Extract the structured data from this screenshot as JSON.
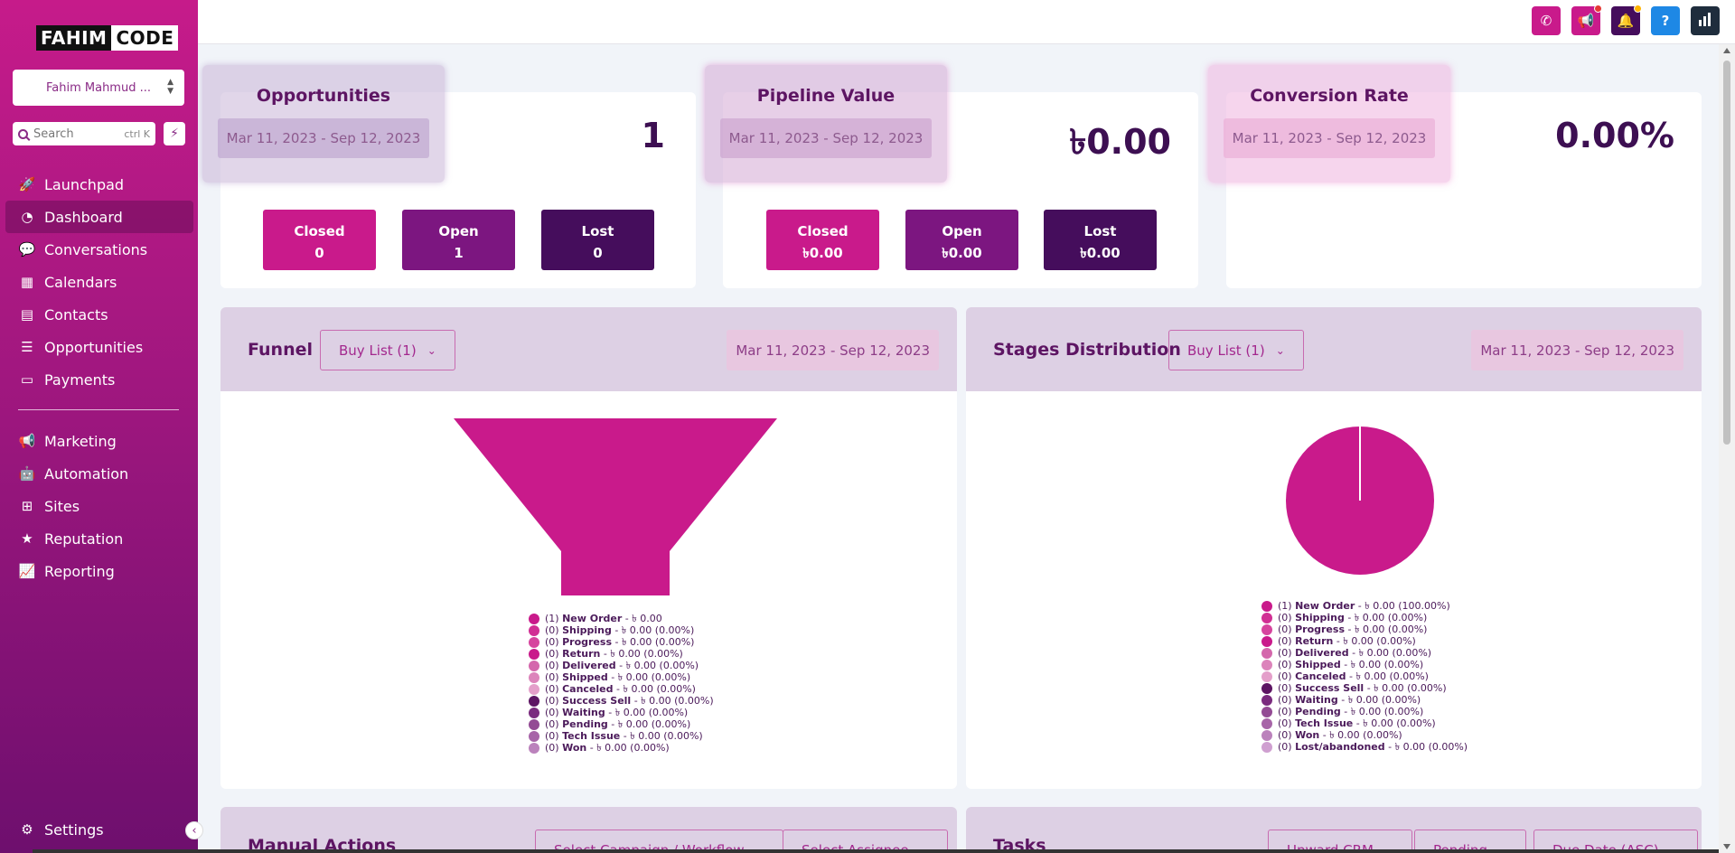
{
  "brand": {
    "part1": "FAHIM",
    "part2": "CODE"
  },
  "account": {
    "name": "Fahim Mahmud ..."
  },
  "search": {
    "placeholder": "Search",
    "shortcut": "ctrl K"
  },
  "sidebar": {
    "items": [
      {
        "label": "Launchpad",
        "icon": "rocket-icon"
      },
      {
        "label": "Dashboard",
        "icon": "dashboard-icon"
      },
      {
        "label": "Conversations",
        "icon": "chat-icon"
      },
      {
        "label": "Calendars",
        "icon": "calendar-icon"
      },
      {
        "label": "Contacts",
        "icon": "contacts-icon"
      },
      {
        "label": "Opportunities",
        "icon": "filter-icon"
      },
      {
        "label": "Payments",
        "icon": "payments-icon"
      },
      {
        "label": "Marketing",
        "icon": "megaphone-icon"
      },
      {
        "label": "Automation",
        "icon": "robot-icon"
      },
      {
        "label": "Sites",
        "icon": "sitemap-icon"
      },
      {
        "label": "Reputation",
        "icon": "star-icon"
      },
      {
        "label": "Reporting",
        "icon": "chart-line-icon"
      }
    ],
    "settings": "Settings"
  },
  "topbar": {
    "colors": {
      "phone": "#c91a8b",
      "announce": "#c91a8b",
      "bell": "#450d5c",
      "help": "#1e88e5",
      "stats": "#1f2d3d"
    },
    "help_label": "?"
  },
  "stats": {
    "opportunities": {
      "title": "Opportunities",
      "range": "Mar 11, 2023 - Sep 12, 2023",
      "value": "1",
      "closed": {
        "label": "Closed",
        "value": "0"
      },
      "open": {
        "label": "Open",
        "value": "1"
      },
      "lost": {
        "label": "Lost",
        "value": "0"
      }
    },
    "pipeline": {
      "title": "Pipeline Value",
      "range": "Mar 11, 2023 - Sep 12, 2023",
      "value": "৳0.00",
      "closed": {
        "label": "Closed",
        "value": "৳0.00"
      },
      "open": {
        "label": "Open",
        "value": "৳0.00"
      },
      "lost": {
        "label": "Lost",
        "value": "৳0.00"
      }
    },
    "conversion": {
      "title": "Conversion Rate",
      "range": "Mar 11, 2023 - Sep 12, 2023",
      "value": "0.00%"
    }
  },
  "funnel": {
    "title": "Funnel",
    "dropdown": "Buy List (1)",
    "range": "Mar 11, 2023 - Sep 12, 2023",
    "legend": [
      {
        "count": "(1)",
        "name": "New Order",
        "rest": "- ৳ 0.00",
        "color": "#c91a8b"
      },
      {
        "count": "(0)",
        "name": "Shipping",
        "rest": "- ৳ 0.00 (0.00%)",
        "color": "#d12f94"
      },
      {
        "count": "(0)",
        "name": "Progress",
        "rest": "- ৳ 0.00 (0.00%)",
        "color": "#d6449e"
      },
      {
        "count": "(0)",
        "name": "Return",
        "rest": "- ৳ 0.00 (0.00%)",
        "color": "#c91a8b"
      },
      {
        "count": "(0)",
        "name": "Delivered",
        "rest": "- ৳ 0.00 (0.00%)",
        "color": "#d467ac"
      },
      {
        "count": "(0)",
        "name": "Shipped",
        "rest": "- ৳ 0.00 (0.00%)",
        "color": "#dc84bb"
      },
      {
        "count": "(0)",
        "name": "Canceled",
        "rest": "- ৳ 0.00 (0.00%)",
        "color": "#e49fca"
      },
      {
        "count": "(0)",
        "name": "Success Sell",
        "rest": "- ৳ 0.00 (0.00%)",
        "color": "#5d1563"
      },
      {
        "count": "(0)",
        "name": "Waiting",
        "rest": "- ৳ 0.00 (0.00%)",
        "color": "#7a2b7e"
      },
      {
        "count": "(0)",
        "name": "Pending",
        "rest": "- ৳ 0.00 (0.00%)",
        "color": "#934b94"
      },
      {
        "count": "(0)",
        "name": "Tech Issue",
        "rest": "- ৳ 0.00 (0.00%)",
        "color": "#a765a8"
      },
      {
        "count": "(0)",
        "name": "Won",
        "rest": "- ৳ 0.00 (0.00%)",
        "color": "#bb82bc"
      }
    ]
  },
  "stages": {
    "title": "Stages Distribution",
    "dropdown": "Buy List (1)",
    "range": "Mar 11, 2023 - Sep 12, 2023",
    "legend": [
      {
        "count": "(1)",
        "name": "New Order",
        "rest": "- ৳ 0.00 (100.00%)",
        "color": "#c91a8b"
      },
      {
        "count": "(0)",
        "name": "Shipping",
        "rest": "- ৳ 0.00 (0.00%)",
        "color": "#d12f94"
      },
      {
        "count": "(0)",
        "name": "Progress",
        "rest": "- ৳ 0.00 (0.00%)",
        "color": "#d6449e"
      },
      {
        "count": "(0)",
        "name": "Return",
        "rest": "- ৳ 0.00 (0.00%)",
        "color": "#c91a8b"
      },
      {
        "count": "(0)",
        "name": "Delivered",
        "rest": "- ৳ 0.00 (0.00%)",
        "color": "#d467ac"
      },
      {
        "count": "(0)",
        "name": "Shipped",
        "rest": "- ৳ 0.00 (0.00%)",
        "color": "#dc84bb"
      },
      {
        "count": "(0)",
        "name": "Canceled",
        "rest": "- ৳ 0.00 (0.00%)",
        "color": "#e49fca"
      },
      {
        "count": "(0)",
        "name": "Success Sell",
        "rest": "- ৳ 0.00 (0.00%)",
        "color": "#5d1563"
      },
      {
        "count": "(0)",
        "name": "Waiting",
        "rest": "- ৳ 0.00 (0.00%)",
        "color": "#7a2b7e"
      },
      {
        "count": "(0)",
        "name": "Pending",
        "rest": "- ৳ 0.00 (0.00%)",
        "color": "#934b94"
      },
      {
        "count": "(0)",
        "name": "Tech Issue",
        "rest": "- ৳ 0.00 (0.00%)",
        "color": "#a765a8"
      },
      {
        "count": "(0)",
        "name": "Won",
        "rest": "- ৳ 0.00 (0.00%)",
        "color": "#bb82bc"
      },
      {
        "count": "(0)",
        "name": "Lost/abandoned",
        "rest": "- ৳ 0.00 (0.00%)",
        "color": "#cf9fd0"
      }
    ]
  },
  "manual_actions": {
    "title": "Manual Actions",
    "dd1": "Select Campaign / Workflow",
    "dd2": "Select Assignee"
  },
  "tasks": {
    "title": "Tasks",
    "dd1": "Upward CRM",
    "dd2": "Pending",
    "dd3": "Due Date (ASC)"
  }
}
